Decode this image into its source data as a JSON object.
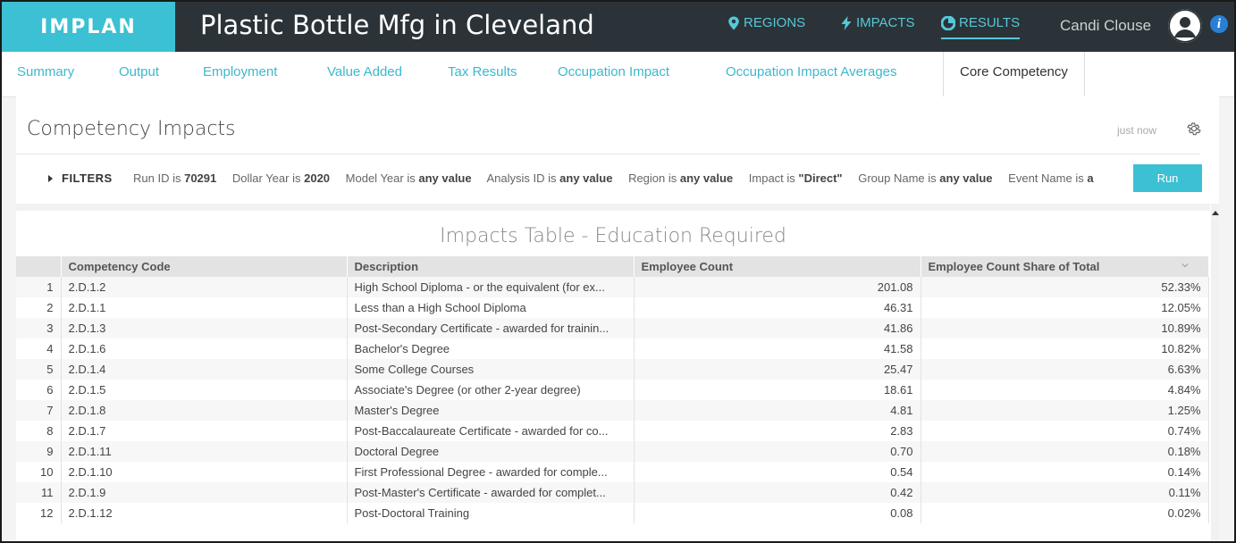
{
  "header": {
    "logo": "IMPLAN",
    "title": "Plastic Bottle Mfg in Cleveland",
    "nav": [
      {
        "label": "REGIONS",
        "icon": "map-pin-icon"
      },
      {
        "label": "IMPACTS",
        "icon": "lightning-icon"
      },
      {
        "label": "RESULTS",
        "icon": "pie-chart-icon",
        "active": true
      }
    ],
    "user": "Candi Clouse",
    "accent_color": "#3cc0d3"
  },
  "tabs": [
    {
      "label": "Summary"
    },
    {
      "label": "Output"
    },
    {
      "label": "Employment"
    },
    {
      "label": "Value Added"
    },
    {
      "label": "Tax Results"
    },
    {
      "label": "Occupation Impact"
    },
    {
      "label": "Occupation Impact Averages"
    },
    {
      "label": "Core Competency",
      "active": true
    }
  ],
  "panel": {
    "title": "Competency Impacts",
    "timestamp": "just now",
    "filters_label": "FILTERS",
    "filters": [
      {
        "key": "Run ID",
        "op": " is ",
        "value": "70291"
      },
      {
        "key": "Dollar Year",
        "op": " is ",
        "value": "2020"
      },
      {
        "key": "Model Year",
        "op": " is ",
        "value": "any value"
      },
      {
        "key": "Analysis ID",
        "op": " is ",
        "value": "any value"
      },
      {
        "key": "Region",
        "op": " is ",
        "value": "any value"
      },
      {
        "key": "Impact",
        "op": " is ",
        "value": "\"Direct\""
      },
      {
        "key": "Group Name",
        "op": " is ",
        "value": "any value"
      },
      {
        "key": "Event Name",
        "op": " is ",
        "value": "a"
      }
    ],
    "run_label": "Run"
  },
  "table": {
    "title": "Impacts Table - Education Required",
    "columns": [
      "Competency Code",
      "Description",
      "Employee Count",
      "Employee Count Share of Total"
    ],
    "rows": [
      [
        "1",
        "2.D.1.2",
        "High School Diploma - or the equivalent (for ex...",
        "201.08",
        "52.33%"
      ],
      [
        "2",
        "2.D.1.1",
        "Less than a High School Diploma",
        "46.31",
        "12.05%"
      ],
      [
        "3",
        "2.D.1.3",
        "Post-Secondary Certificate - awarded for trainin...",
        "41.86",
        "10.89%"
      ],
      [
        "4",
        "2.D.1.6",
        "Bachelor's Degree",
        "41.58",
        "10.82%"
      ],
      [
        "5",
        "2.D.1.4",
        "Some College Courses",
        "25.47",
        "6.63%"
      ],
      [
        "6",
        "2.D.1.5",
        "Associate's Degree (or other 2-year degree)",
        "18.61",
        "4.84%"
      ],
      [
        "7",
        "2.D.1.8",
        "Master's Degree",
        "4.81",
        "1.25%"
      ],
      [
        "8",
        "2.D.1.7",
        "Post-Baccalaureate Certificate - awarded for co...",
        "2.83",
        "0.74%"
      ],
      [
        "9",
        "2.D.1.11",
        "Doctoral Degree",
        "0.70",
        "0.18%"
      ],
      [
        "10",
        "2.D.1.10",
        "First Professional Degree - awarded for comple...",
        "0.54",
        "0.14%"
      ],
      [
        "11",
        "2.D.1.9",
        "Post-Master's Certificate - awarded for complet...",
        "0.42",
        "0.11%"
      ],
      [
        "12",
        "2.D.1.12",
        "Post-Doctoral Training",
        "0.08",
        "0.02%"
      ]
    ]
  }
}
